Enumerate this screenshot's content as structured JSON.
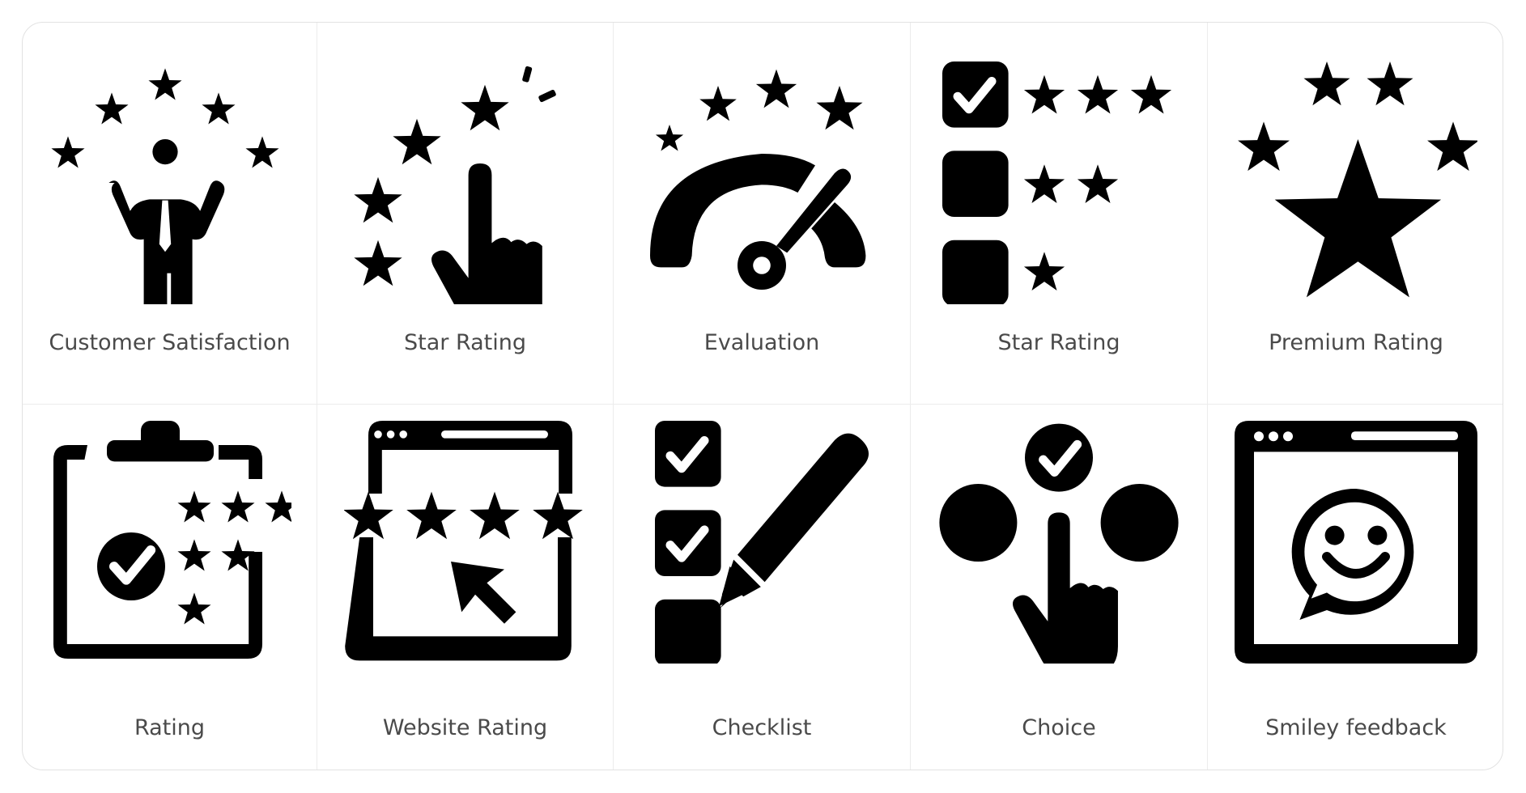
{
  "icons": [
    {
      "label": "Customer Satisfaction",
      "icon": "person-with-stars-icon"
    },
    {
      "label": "Star Rating",
      "icon": "finger-tap-stars-icon"
    },
    {
      "label": "Evaluation",
      "icon": "gauge-stars-icon"
    },
    {
      "label": "Star Rating",
      "icon": "checkbox-star-list-icon"
    },
    {
      "label": "Premium Rating",
      "icon": "big-star-icon"
    },
    {
      "label": "Rating",
      "icon": "clipboard-stars-icon"
    },
    {
      "label": "Website Rating",
      "icon": "browser-stars-cursor-icon"
    },
    {
      "label": "Checklist",
      "icon": "checklist-pencil-icon"
    },
    {
      "label": "Choice",
      "icon": "finger-choice-icon"
    },
    {
      "label": "Smiley feedback",
      "icon": "browser-smiley-icon"
    }
  ],
  "colors": {
    "icon": "#000000",
    "label": "#4a4a4a",
    "border": "#e2e2e2"
  }
}
